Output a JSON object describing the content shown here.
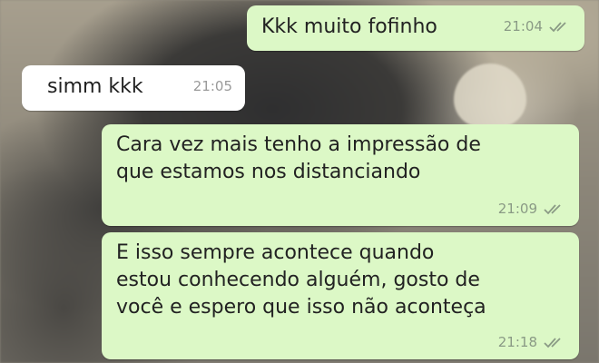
{
  "chat": {
    "messages": [
      {
        "direction": "outgoing",
        "text": "Kkk muito fofinho",
        "time": "21:04",
        "status": "read"
      },
      {
        "direction": "incoming",
        "text": "simm kkk",
        "time": "21:05"
      },
      {
        "direction": "outgoing",
        "text": "Cara vez mais tenho a impressão de\nque estamos nos distanciando",
        "time": "21:09",
        "status": "read"
      },
      {
        "direction": "outgoing",
        "text": "E isso sempre acontece quando\nestou conhecendo alguém, gosto de\nvocê e espero que isso não aconteça",
        "time": "21:18",
        "status": "read"
      }
    ]
  },
  "colors": {
    "outgoing_bubble": "#dcf8c6",
    "incoming_bubble": "#ffffff",
    "read_ticks": "#8a9a85"
  },
  "icons": {
    "status": "double-check-icon"
  }
}
